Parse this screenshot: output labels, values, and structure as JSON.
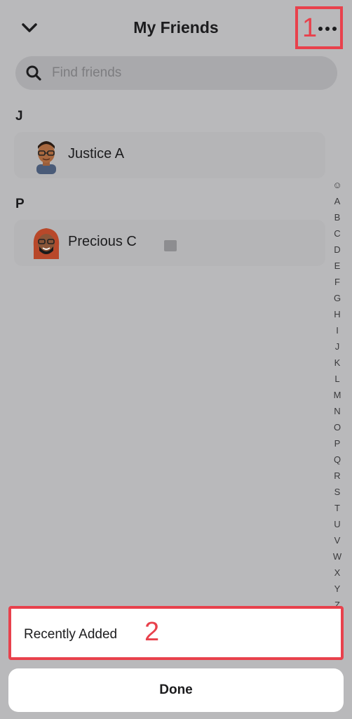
{
  "header": {
    "title": "My Friends",
    "back_icon": "chevron-down-icon",
    "more_icon": "more-dots-icon"
  },
  "annotations": {
    "marker_1": "1",
    "marker_2": "2"
  },
  "search": {
    "placeholder": "Find friends",
    "icon": "search-icon"
  },
  "sections": [
    {
      "letter": "J",
      "friends": [
        {
          "name": "Justice A",
          "avatar": "bitmoji-avatar-male"
        }
      ]
    },
    {
      "letter": "P",
      "friends": [
        {
          "name": "Precious C",
          "avatar": "bitmoji-avatar-female"
        }
      ]
    }
  ],
  "alpha_index": [
    "☺",
    "A",
    "B",
    "C",
    "D",
    "E",
    "F",
    "G",
    "H",
    "I",
    "J",
    "K",
    "L",
    "M",
    "N",
    "O",
    "P",
    "Q",
    "R",
    "S",
    "T",
    "U",
    "V",
    "W",
    "X",
    "Y",
    "Z"
  ],
  "sheet": {
    "recently_added_label": "Recently Added",
    "done_label": "Done"
  },
  "colors": {
    "accent_annotation": "#e8414c",
    "dim_overlay": "#b9b9bb",
    "sheet_bg": "#ffffff"
  }
}
